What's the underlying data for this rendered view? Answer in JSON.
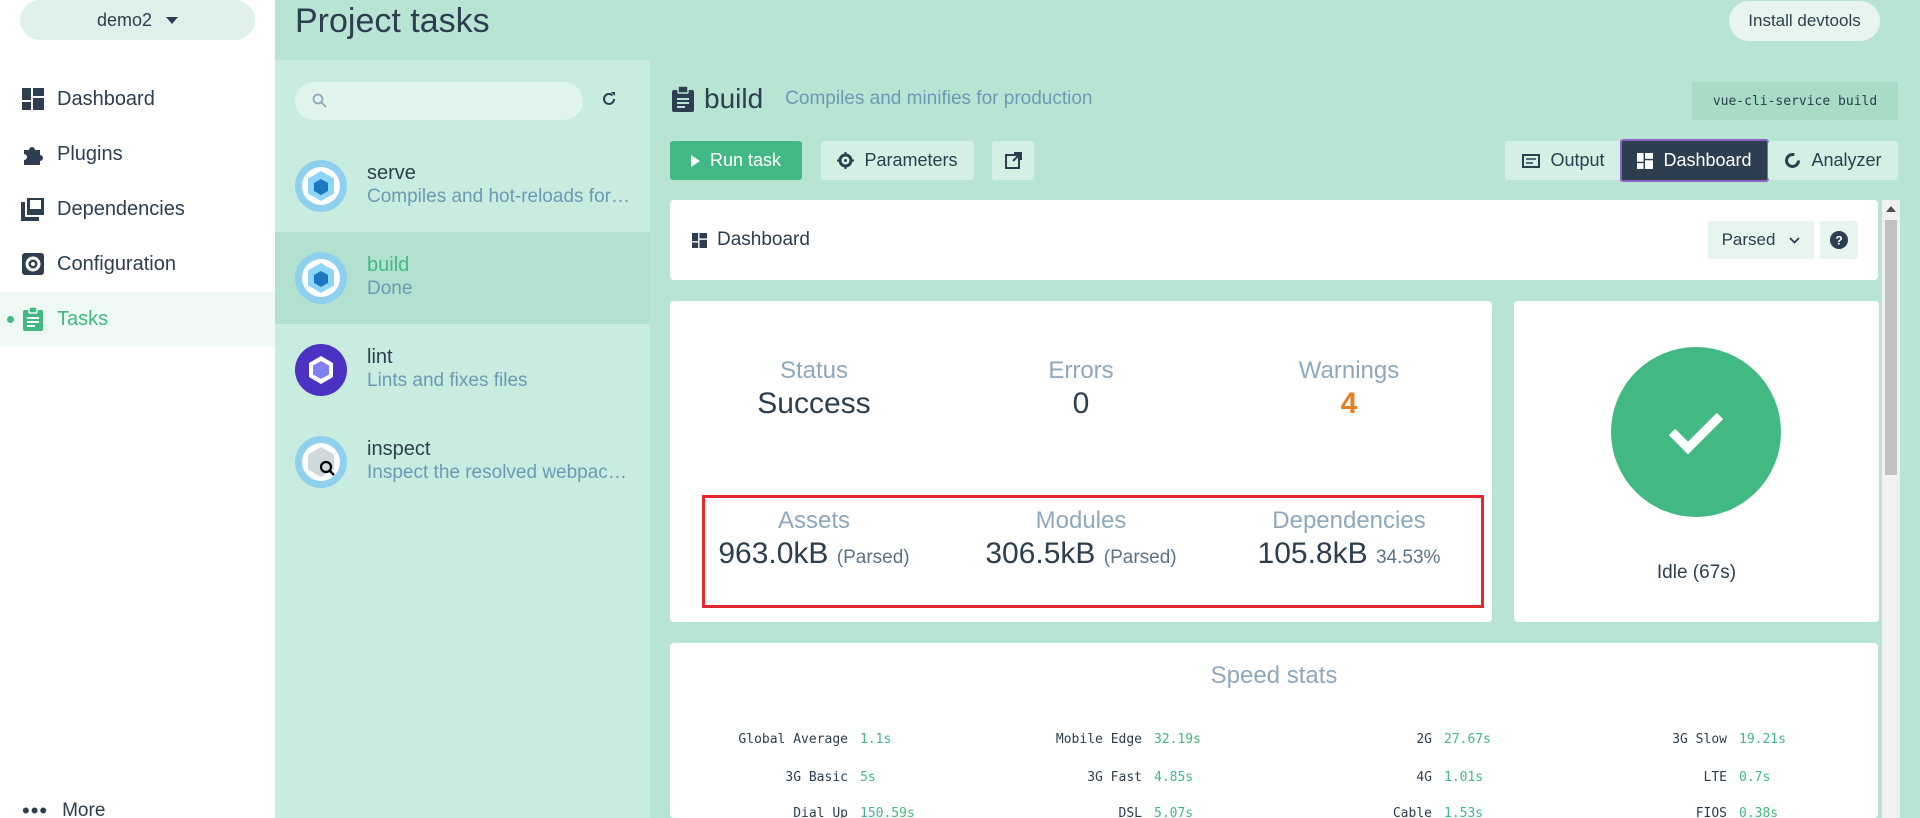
{
  "project": {
    "name": "demo2"
  },
  "nav": {
    "items": [
      {
        "label": "Dashboard",
        "icon": "dashboard-icon"
      },
      {
        "label": "Plugins",
        "icon": "puzzle-icon"
      },
      {
        "label": "Dependencies",
        "icon": "library-icon"
      },
      {
        "label": "Configuration",
        "icon": "gear-icon"
      },
      {
        "label": "Tasks",
        "icon": "clipboard-icon",
        "active": true
      }
    ],
    "more": "More"
  },
  "header": {
    "title": "Project tasks",
    "devtools": "Install devtools"
  },
  "search": {
    "placeholder": ""
  },
  "tasks": [
    {
      "name": "serve",
      "desc": "Compiles and hot-reloads for development"
    },
    {
      "name": "build",
      "desc": "Done",
      "selected": true
    },
    {
      "name": "lint",
      "desc": "Lints and fixes files"
    },
    {
      "name": "inspect",
      "desc": "Inspect the resolved webpack config"
    }
  ],
  "task": {
    "name": "build",
    "desc": "Compiles and minifies for production",
    "command": "vue-cli-service build"
  },
  "actions": {
    "run": "Run task",
    "parameters": "Parameters",
    "output": "Output",
    "dashboard": "Dashboard",
    "analyzer": "Analyzer"
  },
  "dashboard": {
    "title": "Dashboard",
    "mode": "Parsed",
    "status_label": "Status",
    "status_value": "Success",
    "errors_label": "Errors",
    "errors_value": "0",
    "warnings_label": "Warnings",
    "warnings_value": "4",
    "assets_label": "Assets",
    "assets_value": "963.0kB",
    "assets_sub": "(Parsed)",
    "modules_label": "Modules",
    "modules_value": "306.5kB",
    "modules_sub": "(Parsed)",
    "deps_label": "Dependencies",
    "deps_value": "105.8kB",
    "deps_sub": "34.53%",
    "idle": "Idle (67s)"
  },
  "speed": {
    "title": "Speed stats",
    "rows": [
      [
        {
          "n": "Global Average",
          "t": "1.1s"
        },
        {
          "n": "Mobile Edge",
          "t": "32.19s"
        },
        {
          "n": "2G",
          "t": "27.67s"
        },
        {
          "n": "3G Slow",
          "t": "19.21s"
        }
      ],
      [
        {
          "n": "3G Basic",
          "t": "5s"
        },
        {
          "n": "3G Fast",
          "t": "4.85s"
        },
        {
          "n": "4G",
          "t": "1.01s"
        },
        {
          "n": "LTE",
          "t": "0.7s"
        }
      ],
      [
        {
          "n": "Dial Up",
          "t": "150.59s"
        },
        {
          "n": "DSL",
          "t": "5.07s"
        },
        {
          "n": "Cable",
          "t": "1.53s"
        },
        {
          "n": "FIOS",
          "t": "0.38s"
        }
      ]
    ]
  },
  "colors": {
    "accent": "#42b983",
    "warn": "#e67e22",
    "panel": "#b8e5d3"
  }
}
